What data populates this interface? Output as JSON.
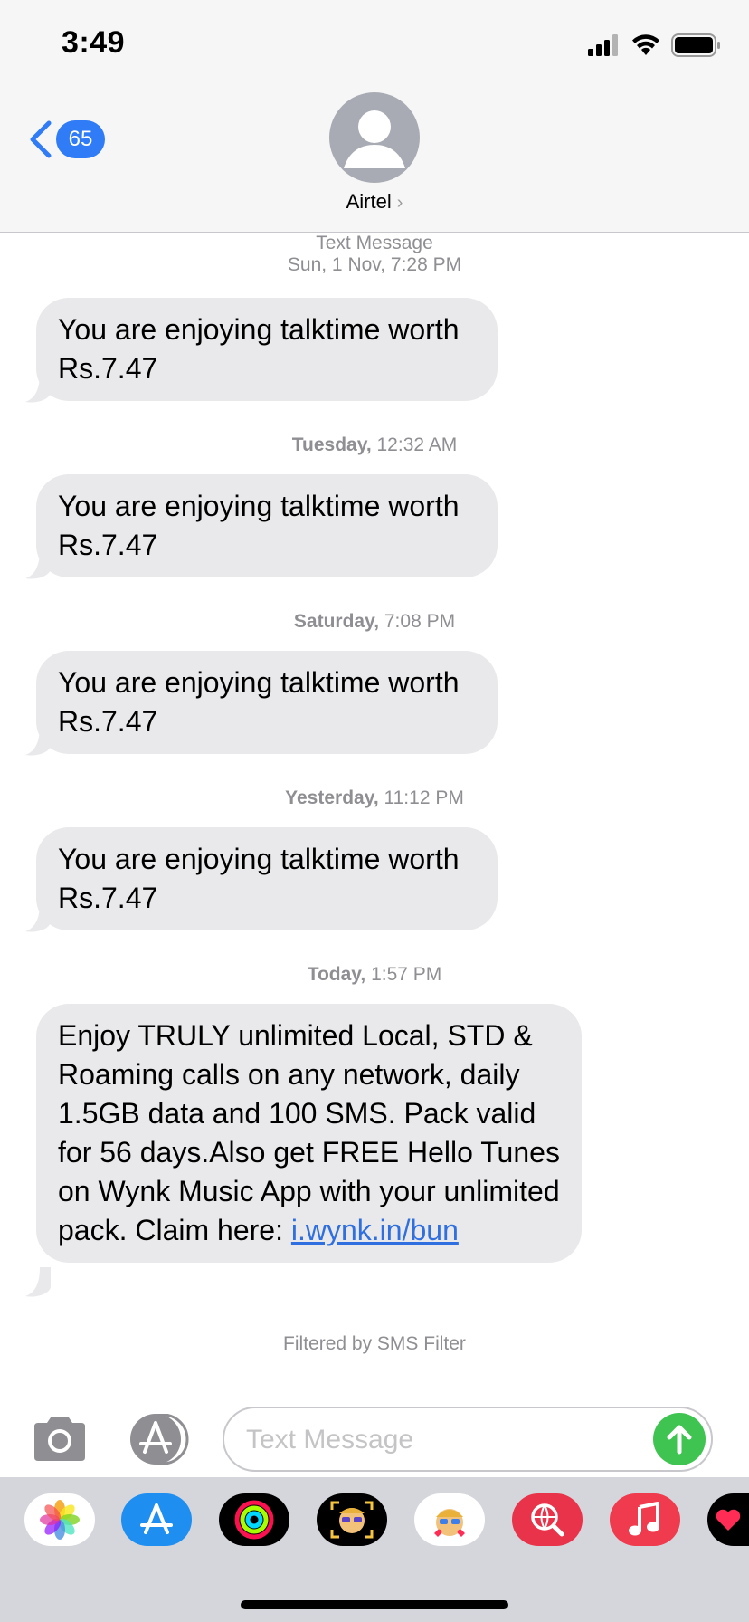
{
  "status_bar": {
    "time": "3:49"
  },
  "header": {
    "back_badge": "65",
    "contact_name": "Airtel",
    "contact_chevron": "›"
  },
  "conversation": {
    "header_label": "Text Message",
    "header_date": "Sun, 1 Nov, 7:28 PM",
    "messages": [
      {
        "text": "You are enjoying talktime worth Rs.7.47"
      },
      {
        "day": "Tuesday,",
        "time": " 12:32 AM",
        "text": "You are enjoying talktime worth Rs.7.47"
      },
      {
        "day": "Saturday,",
        "time": " 7:08 PM",
        "text": "You are enjoying talktime worth Rs.7.47"
      },
      {
        "day": "Yesterday,",
        "time": " 11:12 PM",
        "text": "You are enjoying talktime worth Rs.7.47"
      },
      {
        "day": "Today,",
        "time": " 1:57 PM",
        "text": "Enjoy TRULY unlimited Local, STD & Roaming calls on any network, daily 1.5GB data and 100 SMS. Pack valid for 56 days.Also get FREE Hello Tunes on Wynk Music App with your unlimited pack. Claim here: ",
        "link": "i.wynk.in/bun"
      }
    ],
    "filtered_note": "Filtered by SMS Filter"
  },
  "input": {
    "placeholder": "Text Message"
  },
  "drawer": {
    "icons": [
      "photos-icon",
      "app-store-icon",
      "activity-icon",
      "memoji-camera-icon",
      "memoji-stickers-icon",
      "web-images-icon",
      "music-icon",
      "digital-touch-icon"
    ]
  },
  "colors": {
    "accent": "#2f7cf6",
    "bubble": "#e9e9eb",
    "send": "#3fc452",
    "link": "#2f6fe0"
  }
}
